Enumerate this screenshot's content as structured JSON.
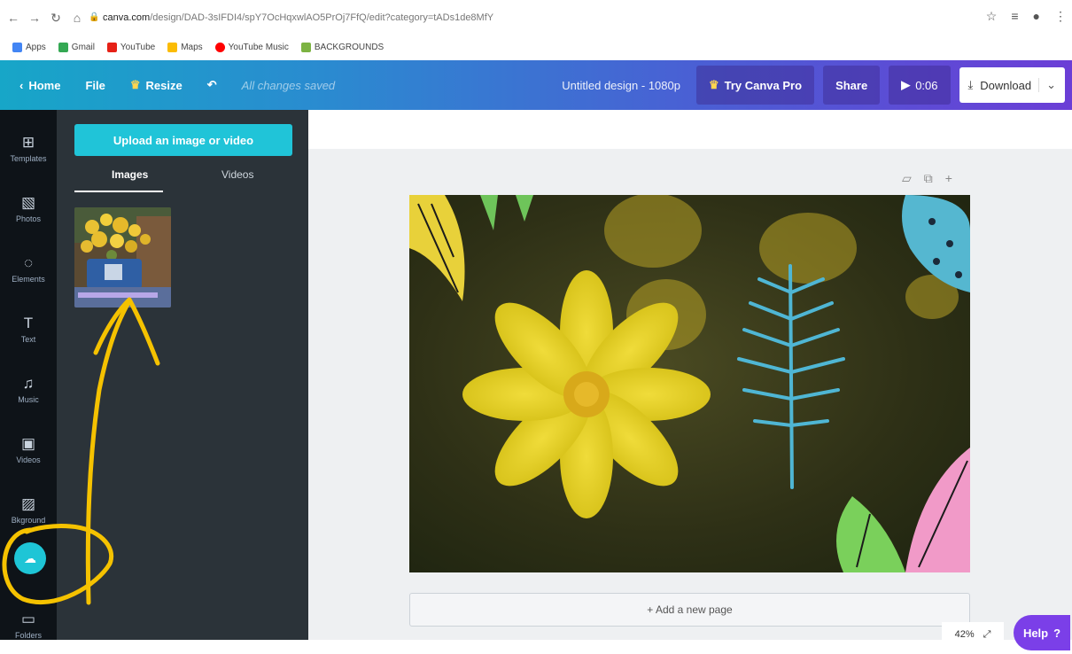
{
  "browser": {
    "url_host": "canva.com",
    "url_path": "/design/DAD-3sIFDI4/spY7OcHqxwlAO5PrOj7FfQ/edit?category=tADs1de8MfY",
    "bookmarks": [
      {
        "label": "Apps",
        "icon": "apps-grid-icon",
        "color": "#4285f4"
      },
      {
        "label": "Gmail",
        "icon": "google-icon",
        "color": "#34a853"
      },
      {
        "label": "YouTube",
        "icon": "youtube-icon",
        "color": "#e62117"
      },
      {
        "label": "Maps",
        "icon": "maps-pin-icon",
        "color": "#fbbc04"
      },
      {
        "label": "YouTube Music",
        "icon": "youtube-music-icon",
        "color": "#ff0000"
      },
      {
        "label": "BACKGROUNDS",
        "icon": "bookmark-folder-icon",
        "color": "#7cb342"
      }
    ]
  },
  "topbar": {
    "home": "Home",
    "file": "File",
    "resize": "Resize",
    "saved_status": "All changes saved",
    "design_title": "Untitled design - 1080p",
    "try_pro": "Try Canva Pro",
    "share": "Share",
    "play_time": "0:06",
    "download": "Download"
  },
  "sidebar": {
    "items": [
      {
        "label": "Templates",
        "icon": "templates-icon",
        "glyph": "⊞"
      },
      {
        "label": "Photos",
        "icon": "photos-icon",
        "glyph": "▧"
      },
      {
        "label": "Elements",
        "icon": "elements-icon",
        "glyph": "◌"
      },
      {
        "label": "Text",
        "icon": "text-icon",
        "glyph": "T"
      },
      {
        "label": "Music",
        "icon": "music-icon",
        "glyph": "♫"
      },
      {
        "label": "Videos",
        "icon": "videos-icon",
        "glyph": "▣"
      },
      {
        "label": "Bkground",
        "icon": "background-icon",
        "glyph": "▨"
      }
    ],
    "folders": "Folders"
  },
  "panel": {
    "upload_button": "Upload an image or video",
    "tab_images": "Images",
    "tab_videos": "Videos"
  },
  "workspace": {
    "add_page": "+ Add a new page",
    "zoom": "42%",
    "help": "Help"
  },
  "colors": {
    "accent_teal": "#20c4d8",
    "help_purple": "#7b3fe8",
    "annotation_yellow": "#f5c200"
  }
}
